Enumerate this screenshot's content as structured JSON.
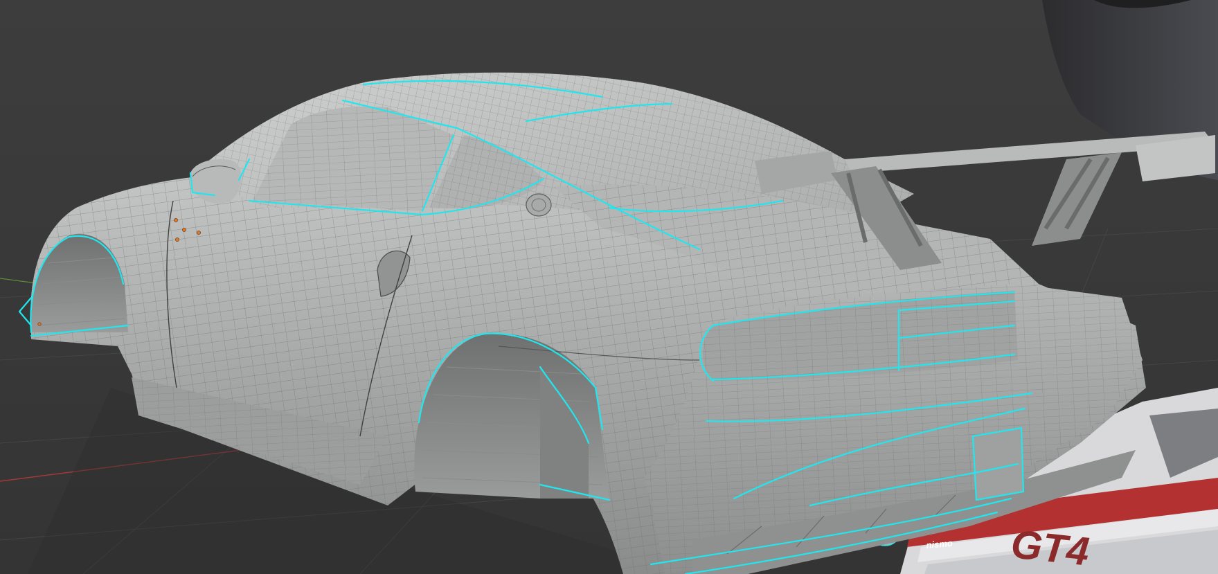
{
  "viewport": {
    "background_color": "#3a3a3a",
    "grid_color": "#4a4a4a",
    "axis_x_color": "#a33a3a",
    "axis_y_color": "#5e8a3a",
    "mesh_base_color": "#a4a6a5",
    "mesh_wire_color": "#6d706f",
    "seam_color": "#22e6ee",
    "vertex_dot_color": "#e0782a"
  },
  "reference_image": {
    "badge_text": "GT4",
    "brand_text": "nismo"
  }
}
